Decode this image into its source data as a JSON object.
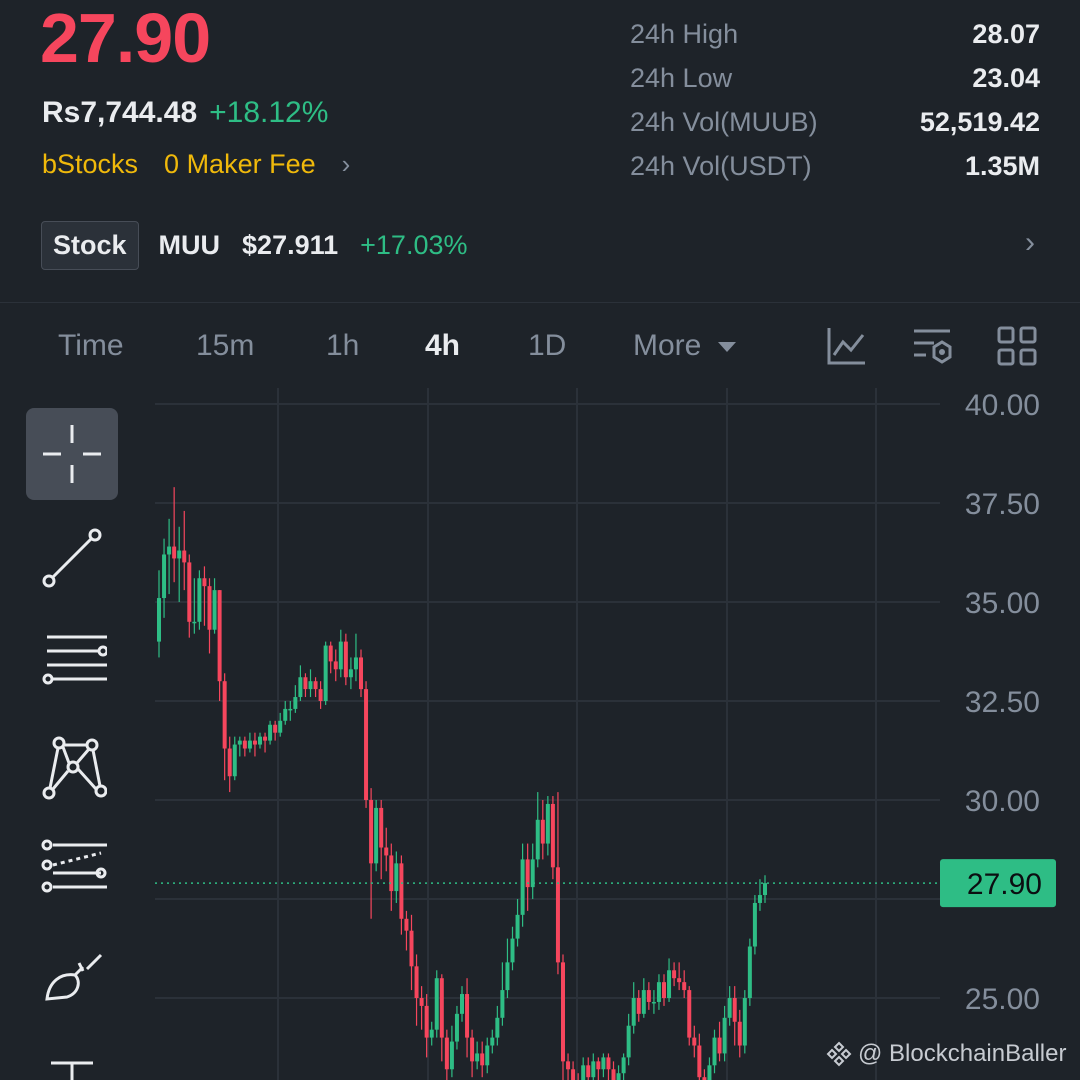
{
  "header": {
    "last_price": "27.90",
    "fiat_value": "Rs7,744.48",
    "change_pct": "+18.12%",
    "promo_brand": "bStocks",
    "promo_text": "0 Maker Fee",
    "stats": [
      {
        "label": "24h High",
        "value": "28.07"
      },
      {
        "label": "24h Low",
        "value": "23.04"
      },
      {
        "label": "24h Vol(MUUB)",
        "value": "52,519.42"
      },
      {
        "label": "24h Vol(USDT)",
        "value": "1.35M"
      }
    ]
  },
  "stock_row": {
    "tag": "Stock",
    "symbol": "MUU",
    "price": "$27.911",
    "change": "+17.03%"
  },
  "tabs": {
    "items": [
      "Time",
      "15m",
      "1h",
      "4h",
      "1D",
      "More"
    ],
    "active": "4h"
  },
  "icons": {
    "toolbar": [
      "chart-indicator-icon",
      "chart-settings-icon",
      "layout-grid-icon"
    ],
    "drawing_tools": [
      "crosshair-icon",
      "trend-line-icon",
      "horizontal-lines-icon",
      "pattern-icon",
      "fib-lines-icon",
      "brush-icon",
      "text-icon"
    ]
  },
  "colors": {
    "up": "#2ebd85",
    "down": "#f6465d",
    "background": "#1e2329",
    "accent": "#f0b90b"
  },
  "chart_data": {
    "type": "candlestick",
    "y_ticks": [
      "40.00",
      "37.50",
      "35.00",
      "32.50",
      "30.00",
      "25.00"
    ],
    "ylim": [
      22.3,
      40.0
    ],
    "current_price_label": "27.90",
    "current_price": 27.9,
    "candles": [
      [
        34.0,
        35.1,
        33.6,
        35.8
      ],
      [
        35.1,
        36.2,
        34.6,
        36.6
      ],
      [
        36.2,
        36.4,
        35.2,
        37.1
      ],
      [
        36.4,
        36.1,
        35.5,
        37.9
      ],
      [
        36.1,
        36.3,
        35.0,
        36.9
      ],
      [
        36.3,
        36.0,
        35.3,
        37.3
      ],
      [
        36.0,
        34.5,
        34.1,
        36.2
      ],
      [
        34.5,
        34.5,
        34.2,
        35.6
      ],
      [
        34.5,
        35.6,
        34.3,
        35.8
      ],
      [
        35.6,
        35.4,
        34.4,
        35.9
      ],
      [
        35.4,
        34.3,
        33.7,
        35.6
      ],
      [
        34.3,
        35.3,
        34.2,
        35.6
      ],
      [
        35.3,
        33.0,
        32.5,
        35.3
      ],
      [
        33.0,
        31.3,
        30.5,
        33.2
      ],
      [
        31.3,
        30.6,
        30.2,
        31.6
      ],
      [
        30.6,
        31.4,
        30.5,
        31.6
      ],
      [
        31.4,
        31.5,
        31.1,
        31.6
      ],
      [
        31.5,
        31.3,
        31.1,
        31.6
      ],
      [
        31.3,
        31.5,
        31.2,
        31.7
      ],
      [
        31.5,
        31.4,
        31.1,
        31.7
      ],
      [
        31.4,
        31.6,
        31.3,
        31.7
      ],
      [
        31.6,
        31.5,
        31.2,
        31.7
      ],
      [
        31.5,
        31.9,
        31.4,
        32.0
      ],
      [
        31.9,
        31.7,
        31.5,
        32.0
      ],
      [
        31.7,
        32.0,
        31.6,
        32.2
      ],
      [
        32.0,
        32.3,
        31.9,
        32.5
      ],
      [
        32.3,
        32.3,
        32.0,
        32.5
      ],
      [
        32.3,
        32.6,
        32.2,
        32.9
      ],
      [
        32.6,
        33.1,
        32.5,
        33.4
      ],
      [
        33.1,
        32.8,
        32.6,
        33.2
      ],
      [
        32.8,
        33.0,
        32.6,
        33.3
      ],
      [
        33.0,
        32.8,
        32.6,
        33.1
      ],
      [
        32.8,
        32.5,
        32.3,
        33.0
      ],
      [
        32.5,
        33.9,
        32.4,
        34.0
      ],
      [
        33.9,
        33.5,
        33.2,
        34.0
      ],
      [
        33.5,
        33.3,
        33.0,
        33.8
      ],
      [
        33.3,
        34.0,
        33.1,
        34.3
      ],
      [
        34.0,
        33.1,
        32.9,
        34.2
      ],
      [
        33.1,
        33.3,
        32.8,
        33.6
      ],
      [
        33.3,
        33.6,
        33.0,
        34.2
      ],
      [
        33.6,
        32.8,
        32.6,
        33.8
      ],
      [
        32.8,
        30.0,
        29.8,
        33.0
      ],
      [
        30.0,
        28.4,
        27.0,
        30.3
      ],
      [
        28.4,
        29.8,
        28.2,
        30.0
      ],
      [
        29.8,
        28.8,
        28.0,
        30.0
      ],
      [
        28.8,
        28.6,
        28.2,
        29.3
      ],
      [
        28.6,
        27.7,
        27.2,
        28.9
      ],
      [
        27.7,
        28.4,
        27.4,
        28.7
      ],
      [
        28.4,
        27.0,
        26.6,
        28.6
      ],
      [
        27.0,
        26.7,
        26.2,
        27.2
      ],
      [
        26.7,
        25.8,
        25.2,
        27.1
      ],
      [
        25.8,
        25.0,
        24.3,
        26.1
      ],
      [
        25.0,
        24.8,
        24.2,
        25.3
      ],
      [
        24.8,
        24.0,
        23.5,
        25.1
      ],
      [
        24.0,
        24.2,
        23.8,
        24.4
      ],
      [
        24.2,
        25.5,
        24.0,
        25.7
      ],
      [
        25.5,
        24.0,
        23.4,
        25.6
      ],
      [
        24.0,
        23.2,
        22.8,
        24.2
      ],
      [
        23.2,
        23.9,
        23.0,
        24.3
      ],
      [
        23.9,
        24.6,
        23.7,
        24.8
      ],
      [
        24.6,
        25.1,
        24.4,
        25.3
      ],
      [
        25.1,
        24.0,
        23.5,
        25.5
      ],
      [
        24.0,
        23.4,
        23.0,
        24.2
      ],
      [
        23.4,
        23.6,
        23.2,
        23.9
      ],
      [
        23.6,
        23.3,
        23.0,
        23.9
      ],
      [
        23.3,
        23.8,
        23.1,
        24.0
      ],
      [
        23.8,
        24.0,
        23.6,
        24.2
      ],
      [
        24.0,
        24.5,
        23.8,
        24.8
      ],
      [
        24.5,
        25.2,
        24.3,
        25.9
      ],
      [
        25.2,
        25.9,
        25.0,
        26.5
      ],
      [
        25.9,
        26.5,
        25.7,
        26.8
      ],
      [
        26.5,
        27.1,
        26.3,
        27.5
      ],
      [
        27.1,
        28.5,
        26.8,
        28.9
      ],
      [
        28.5,
        27.8,
        27.2,
        28.9
      ],
      [
        27.8,
        28.5,
        27.5,
        28.9
      ],
      [
        28.5,
        29.5,
        28.3,
        30.2
      ],
      [
        29.5,
        28.9,
        28.5,
        30.0
      ],
      [
        28.9,
        29.9,
        28.6,
        30.1
      ],
      [
        29.9,
        28.3,
        28.0,
        30.1
      ],
      [
        28.3,
        25.9,
        25.6,
        30.2
      ],
      [
        25.9,
        23.4,
        22.9,
        26.1
      ],
      [
        23.4,
        23.2,
        22.8,
        23.6
      ],
      [
        23.2,
        22.9,
        22.6,
        23.4
      ],
      [
        22.9,
        22.6,
        22.4,
        23.1
      ],
      [
        22.6,
        23.3,
        22.5,
        23.5
      ],
      [
        23.3,
        23.0,
        22.8,
        23.5
      ],
      [
        23.0,
        23.4,
        22.9,
        23.6
      ],
      [
        23.4,
        23.2,
        22.9,
        23.5
      ],
      [
        23.2,
        23.5,
        23.0,
        23.6
      ],
      [
        23.5,
        23.2,
        22.9,
        23.6
      ],
      [
        23.2,
        22.8,
        22.5,
        23.4
      ],
      [
        22.8,
        23.1,
        22.7,
        23.3
      ],
      [
        23.1,
        23.5,
        22.9,
        23.6
      ],
      [
        23.5,
        24.3,
        23.3,
        24.6
      ],
      [
        24.3,
        25.0,
        24.1,
        25.4
      ],
      [
        25.0,
        24.6,
        24.4,
        25.2
      ],
      [
        24.6,
        25.2,
        24.5,
        25.5
      ],
      [
        25.2,
        24.9,
        24.7,
        25.4
      ],
      [
        24.9,
        24.9,
        24.6,
        25.2
      ],
      [
        24.9,
        25.4,
        24.7,
        25.6
      ],
      [
        25.4,
        25.0,
        24.8,
        25.6
      ],
      [
        25.0,
        25.7,
        24.9,
        26.0
      ],
      [
        25.7,
        25.5,
        25.3,
        25.9
      ],
      [
        25.5,
        25.4,
        25.2,
        25.9
      ],
      [
        25.4,
        25.2,
        25.0,
        25.7
      ],
      [
        25.2,
        24.0,
        23.8,
        25.3
      ],
      [
        24.0,
        23.8,
        23.5,
        24.3
      ],
      [
        23.8,
        23.0,
        22.8,
        24.1
      ],
      [
        23.0,
        22.6,
        22.4,
        23.2
      ],
      [
        22.6,
        23.3,
        22.5,
        23.5
      ],
      [
        23.3,
        24.0,
        23.1,
        24.2
      ],
      [
        24.0,
        23.6,
        23.4,
        24.4
      ],
      [
        23.6,
        24.5,
        23.4,
        24.8
      ],
      [
        24.5,
        25.0,
        24.3,
        25.3
      ],
      [
        25.0,
        24.4,
        23.8,
        25.3
      ],
      [
        24.4,
        23.8,
        23.5,
        24.7
      ],
      [
        23.8,
        25.0,
        23.6,
        25.2
      ],
      [
        25.0,
        26.3,
        24.8,
        26.5
      ],
      [
        26.3,
        27.4,
        26.1,
        27.6
      ],
      [
        27.4,
        27.6,
        27.2,
        28.0
      ],
      [
        27.6,
        27.9,
        27.4,
        28.1
      ]
    ]
  }
}
